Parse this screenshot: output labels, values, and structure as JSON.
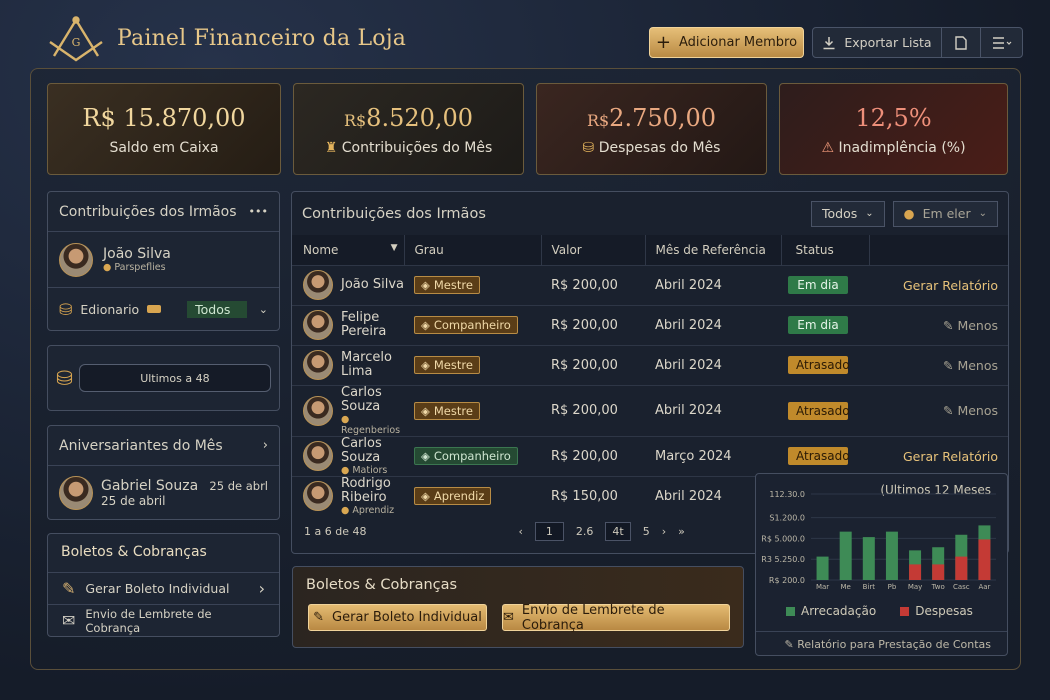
{
  "header": {
    "title": "Painel Financeiro da Loja",
    "add_member": "Adicionar Membro",
    "export_list": "Exportar Lista"
  },
  "stats": [
    {
      "currency": "R$",
      "value": "15.870,00",
      "label": "Saldo em Caixa"
    },
    {
      "currency": "R$",
      "value": "8.520,00",
      "label": "Contribuições do Mês",
      "icon": "money-bag-icon"
    },
    {
      "currency": "R$",
      "value": "2.750,00",
      "label": "Despesas do Mês",
      "icon": "coins-icon"
    },
    {
      "currency": "",
      "value": "12,5%",
      "label": "Inadimplência (%)",
      "icon": "warning-icon"
    }
  ],
  "sidebar": {
    "contrib": {
      "title": "Contribuições dos Irmãos",
      "more": "•••",
      "name": "João Silva",
      "sub": "Parspeflies",
      "filter_label": "Edionario",
      "filter_value": "Todos"
    },
    "last": {
      "label": "Ultimos a  48"
    },
    "birthdays": {
      "title": "Aniversariantes do Mês",
      "name": "Gabriel Souza",
      "date_right": "25 de abrl",
      "date_below": "25 de abril"
    },
    "boletos": {
      "title": "Boletos & Cobranças",
      "individual": "Gerar Boleto Individual",
      "reminder": "Envio de Lembrete de Cobrança"
    }
  },
  "table": {
    "title": "Contribuições dos Irmãos",
    "filter_all": "Todos",
    "filter_state": "Em eler",
    "headers": [
      "Nome",
      "Grau",
      "Valor",
      "Mês de Referência",
      "Status"
    ],
    "rows": [
      {
        "name": "João Silva",
        "sub": "",
        "grade": "Mestre",
        "grade_style": "gold",
        "value": "R$ 200,00",
        "month": "Abril 2024",
        "status": "Em dia",
        "status_style": "ok",
        "action": "Gerar Relatório",
        "action_style": "gen"
      },
      {
        "name": "Felipe Pereira",
        "sub": "",
        "grade": "Companheiro",
        "grade_style": "gold",
        "value": "R$ 200,00",
        "month": "Abril 2024",
        "status": "Em dia",
        "status_style": "ok",
        "action": "Menos",
        "action_style": "less"
      },
      {
        "name": "Marcelo Lima",
        "sub": "",
        "grade": "Mestre",
        "grade_style": "gold",
        "value": "R$ 200,00",
        "month": "Abril 2024",
        "status": "Atrasado",
        "status_style": "late",
        "action": "Menos",
        "action_style": "less"
      },
      {
        "name": "Carlos Souza",
        "sub": "Regenberios",
        "grade": "Mestre",
        "grade_style": "gold",
        "value": "R$ 200,00",
        "month": "Abril 2024",
        "status": "Atrasado",
        "status_style": "late",
        "action": "Menos",
        "action_style": "less"
      },
      {
        "name": "Carlos Souza",
        "sub": "Matiors",
        "grade": "Companheiro",
        "grade_style": "green",
        "value": "R$ 200,00",
        "month": "Março 2024",
        "status": "Atrasado",
        "status_style": "late",
        "action": "Gerar Relatório",
        "action_style": "gen"
      },
      {
        "name": "Rodrigo Ribeiro",
        "sub": "Aprendiz",
        "grade": "Aprendiz",
        "grade_style": "gold",
        "value": "R$ 150,00",
        "month": "Abril 2024",
        "status": "",
        "status_style": "",
        "action": "",
        "action_style": ""
      }
    ],
    "pagination": {
      "summary": "1 a 6 de 48",
      "prev": "‹",
      "pages": [
        "1",
        "2.6",
        "4t",
        "5"
      ],
      "next": "›",
      "last": "»"
    }
  },
  "boletos_main": {
    "title": "Boletos & Cobranças",
    "individual": "Gerar Boleto Individual",
    "reminder": "Envio de Lembrete de Cobrança"
  },
  "chart_data": {
    "type": "bar",
    "title": "(Ultimos 12 Meses",
    "categories": [
      "Mar",
      "Me",
      "Birt",
      "Pb",
      "May",
      "Two",
      "Casc",
      "Aar"
    ],
    "ytick_labels": [
      "112.30.0",
      "S1.200.0",
      "R$ 5.000.0",
      "R3 5.250.0",
      "R$ 200.0"
    ],
    "series": [
      {
        "name": "Arrecadação",
        "color": "#3e8b56",
        "values": [
          0.3,
          0.62,
          0.55,
          0.62,
          0.38,
          0.42,
          0.58,
          0.7
        ]
      },
      {
        "name": "Despesas",
        "color": "#c43a35",
        "values": [
          0,
          0,
          0,
          0,
          0.2,
          0.2,
          0.3,
          0.52
        ]
      }
    ],
    "footer": "Relatório para Prestação de Contas"
  }
}
